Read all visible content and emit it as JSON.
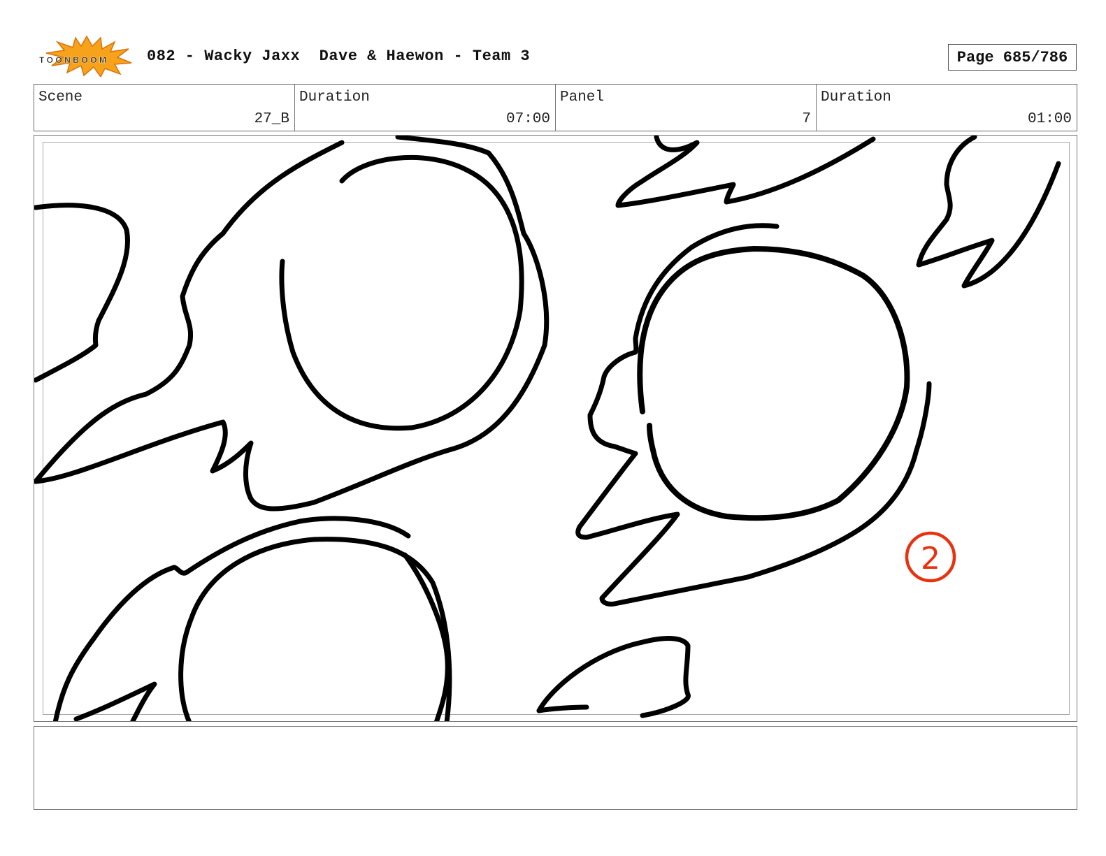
{
  "header": {
    "logo_text": "TOONBOOM",
    "title": "082 - Wacky Jaxx  Dave & Haewon - Team 3",
    "page": "Page 685/786"
  },
  "info": {
    "scene_label": "Scene",
    "scene_value": "27_B",
    "scene_duration_label": "Duration",
    "scene_duration_value": "07:00",
    "panel_label": "Panel",
    "panel_value": "7",
    "panel_duration_label": "Duration",
    "panel_duration_value": "01:00"
  },
  "panel": {
    "annotation": "2",
    "ink_color": "#000000",
    "annotation_color": "#e8320f"
  },
  "notes": {
    "text": ""
  }
}
